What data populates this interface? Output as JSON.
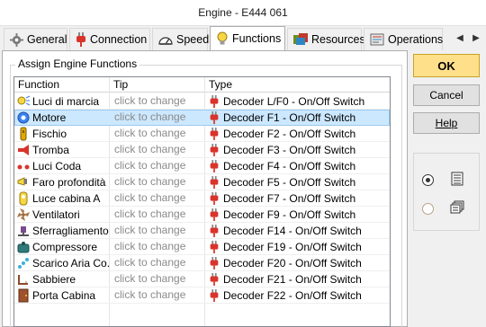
{
  "window": {
    "title": "Engine - E444 061"
  },
  "tabs": [
    {
      "label": "General",
      "icon": "gear-icon",
      "active": false
    },
    {
      "label": "Connection",
      "icon": "plug-icon",
      "active": false
    },
    {
      "label": "Speed",
      "icon": "speedometer-icon",
      "active": false
    },
    {
      "label": "Functions",
      "icon": "lightbulb-icon",
      "active": true
    },
    {
      "label": "Resources",
      "icon": "resources-icon",
      "active": false
    },
    {
      "label": "Operations",
      "icon": "operations-icon",
      "active": false
    }
  ],
  "tab_nav": {
    "prev": "◀",
    "next": "▶"
  },
  "group": {
    "label": "Assign Engine Functions"
  },
  "columns": {
    "function": "Function",
    "tip": "Tip",
    "type": "Type"
  },
  "rows": [
    {
      "function": "Luci di marcia",
      "icon": "headlight-icon",
      "tip": "click to change",
      "type": "Decoder L/F0 - On/Off Switch",
      "selected": false
    },
    {
      "function": "Motore",
      "icon": "motor-icon",
      "tip": "click to change",
      "type": "Decoder F1 - On/Off Switch",
      "selected": true
    },
    {
      "function": "Fischio",
      "icon": "whistle-icon",
      "tip": "click to change",
      "type": "Decoder F2 - On/Off Switch",
      "selected": false
    },
    {
      "function": "Tromba",
      "icon": "horn-icon",
      "tip": "click to change",
      "type": "Decoder F3 - On/Off Switch",
      "selected": false
    },
    {
      "function": "Luci Coda",
      "icon": "tail-lights-icon",
      "tip": "click to change",
      "type": "Decoder F4 - On/Off Switch",
      "selected": false
    },
    {
      "function": "Faro profondità",
      "icon": "spotlight-icon",
      "tip": "click to change",
      "type": "Decoder F5 - On/Off Switch",
      "selected": false
    },
    {
      "function": "Luce cabina A",
      "icon": "cab-light-icon",
      "tip": "click to change",
      "type": "Decoder F7 - On/Off Switch",
      "selected": false
    },
    {
      "function": "Ventilatori",
      "icon": "fan-icon",
      "tip": "click to change",
      "type": "Decoder F9 - On/Off Switch",
      "selected": false
    },
    {
      "function": "Sferragliamento",
      "icon": "rail-noise-icon",
      "tip": "click to change",
      "type": "Decoder F14 - On/Off Switch",
      "selected": false
    },
    {
      "function": "Compressore",
      "icon": "compressor-icon",
      "tip": "click to change",
      "type": "Decoder F19 - On/Off Switch",
      "selected": false
    },
    {
      "function": "Scarico Aria Co...",
      "icon": "air-release-icon",
      "tip": "click to change",
      "type": "Decoder F20 - On/Off Switch",
      "selected": false
    },
    {
      "function": "Sabbiere",
      "icon": "sander-icon",
      "tip": "click to change",
      "type": "Decoder F21 - On/Off Switch",
      "selected": false
    },
    {
      "function": "Porta Cabina",
      "icon": "door-icon",
      "tip": "click to change",
      "type": "Decoder F22 - On/Off Switch",
      "selected": false
    }
  ],
  "buttons": {
    "ok": "OK",
    "cancel": "Cancel",
    "help": "Help"
  },
  "view_options": [
    {
      "icon": "details-view-icon",
      "checked": true
    },
    {
      "icon": "tiles-view-icon",
      "checked": false
    }
  ],
  "colors": {
    "selected_row": "#cce8ff",
    "ok_button": "#ffe08a",
    "plug_red": "#d9342b"
  }
}
